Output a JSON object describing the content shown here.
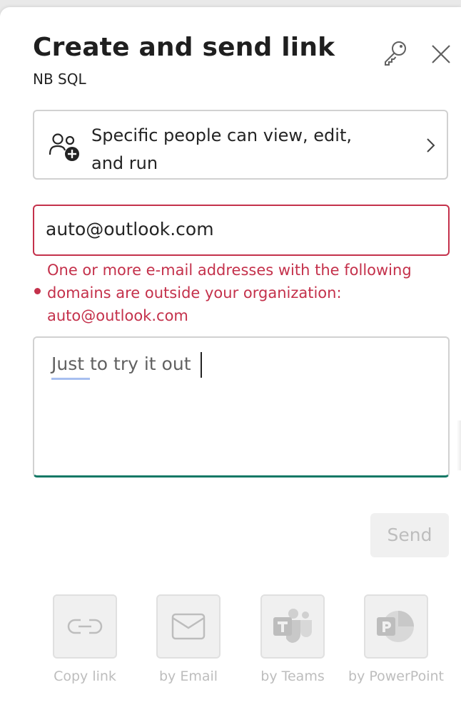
{
  "header": {
    "title": "Create and send link",
    "subtitle": "NB SQL"
  },
  "permission": {
    "label": "Specific people can view, edit, and run"
  },
  "recipient": {
    "value": "auto@outlook.com",
    "error": "One or more e-mail addresses with the following domains are outside your organization: auto@outlook.com"
  },
  "message": {
    "value": "Just to try it out"
  },
  "send_label": "Send",
  "share_options": [
    {
      "label": "Copy link",
      "icon": "link-icon"
    },
    {
      "label": "by Email",
      "icon": "mail-icon"
    },
    {
      "label": "by Teams",
      "icon": "teams-icon"
    },
    {
      "label": "by PowerPoint",
      "icon": "powerpoint-icon"
    }
  ],
  "colors": {
    "error": "#c4314b",
    "focus_underline": "#117865",
    "disabled_text": "#bdbdbd"
  }
}
